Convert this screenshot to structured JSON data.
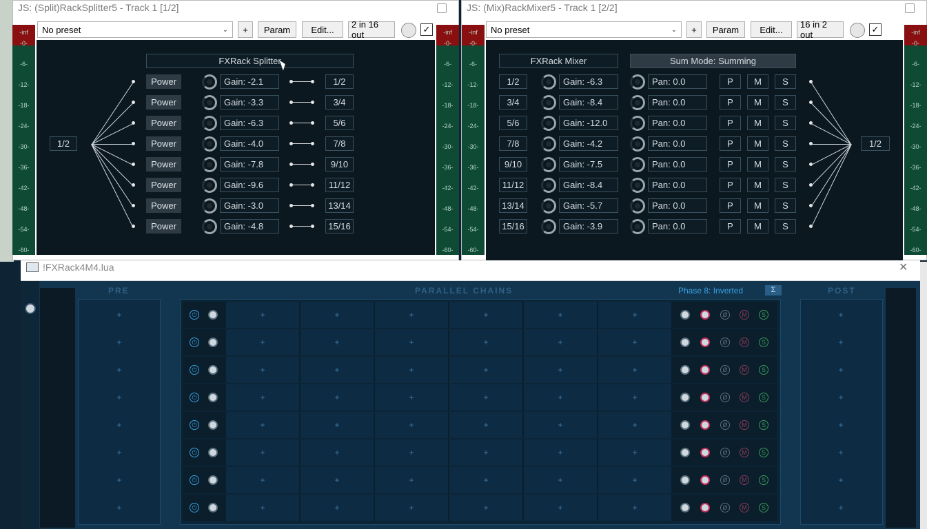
{
  "splitter_window": {
    "title": "JS: (Split)RackSplitter5 - Track 1 [1/2]",
    "preset": "No preset",
    "plus_label": "+",
    "param_label": "Param",
    "edit_label": "Edit...",
    "io_label": "2 in 16 out",
    "check": "✓",
    "panel_title": "FXRack Splitter",
    "input_label": "1/2",
    "power_label": "Power",
    "rows": [
      {
        "gain": "Gain: -2.1",
        "out": "1/2"
      },
      {
        "gain": "Gain: -3.3",
        "out": "3/4"
      },
      {
        "gain": "Gain: -6.3",
        "out": "5/6"
      },
      {
        "gain": "Gain: -4.0",
        "out": "7/8"
      },
      {
        "gain": "Gain: -7.8",
        "out": "9/10"
      },
      {
        "gain": "Gain: -9.6",
        "out": "11/12"
      },
      {
        "gain": "Gain: -3.0",
        "out": "13/14"
      },
      {
        "gain": "Gain: -4.8",
        "out": "15/16"
      }
    ]
  },
  "mixer_window": {
    "title": "JS: (Mix)RackMixer5 - Track 1 [2/2]",
    "preset": "No preset",
    "plus_label": "+",
    "param_label": "Param",
    "edit_label": "Edit...",
    "io_label": "16 in 2 out",
    "check": "✓",
    "panel_title": "FXRack Mixer",
    "sum_mode": "Sum Mode: Summing",
    "output_label": "1/2",
    "p_label": "P",
    "m_label": "M",
    "s_label": "S",
    "rows": [
      {
        "in": "1/2",
        "gain": "Gain: -6.3",
        "pan": "Pan: 0.0"
      },
      {
        "in": "3/4",
        "gain": "Gain: -8.4",
        "pan": "Pan: 0.0"
      },
      {
        "in": "5/6",
        "gain": "Gain: -12.0",
        "pan": "Pan: 0.0"
      },
      {
        "in": "7/8",
        "gain": "Gain: -4.2",
        "pan": "Pan: 0.0"
      },
      {
        "in": "9/10",
        "gain": "Gain: -7.5",
        "pan": "Pan: 0.0"
      },
      {
        "in": "11/12",
        "gain": "Gain: -8.4",
        "pan": "Pan: 0.0"
      },
      {
        "in": "13/14",
        "gain": "Gain: -5.7",
        "pan": "Pan: 0.0"
      },
      {
        "in": "15/16",
        "gain": "Gain: -3.9",
        "pan": "Pan: 0.0"
      }
    ]
  },
  "meter_ticks": [
    "-inf",
    "-0-",
    "-6-",
    "-12-",
    "-18-",
    "-24-",
    "-30-",
    "-36-",
    "-42-",
    "-48-",
    "-54-",
    "-60-"
  ],
  "fxrack": {
    "title": "!FXRack4M4.lua",
    "close": "✕",
    "pre_label": "PRE",
    "chains_label": "PARALLEL CHAINS",
    "post_label": "POST",
    "phase_label": "Phase 8:  Inverted",
    "sigma": "Σ",
    "slot_plus": "+",
    "phase_glyph": "Ø",
    "mute_glyph": "M",
    "solo_glyph": "S",
    "power_glyph": "⏻"
  },
  "colors": {
    "meter_green": "#0f4a35",
    "meter_red": "#8a0f10",
    "rack_bg": "#0e2434",
    "accent_blue": "#3aa0e0",
    "solo_green": "#3a9a5a",
    "knob_red": "#c0305a"
  }
}
